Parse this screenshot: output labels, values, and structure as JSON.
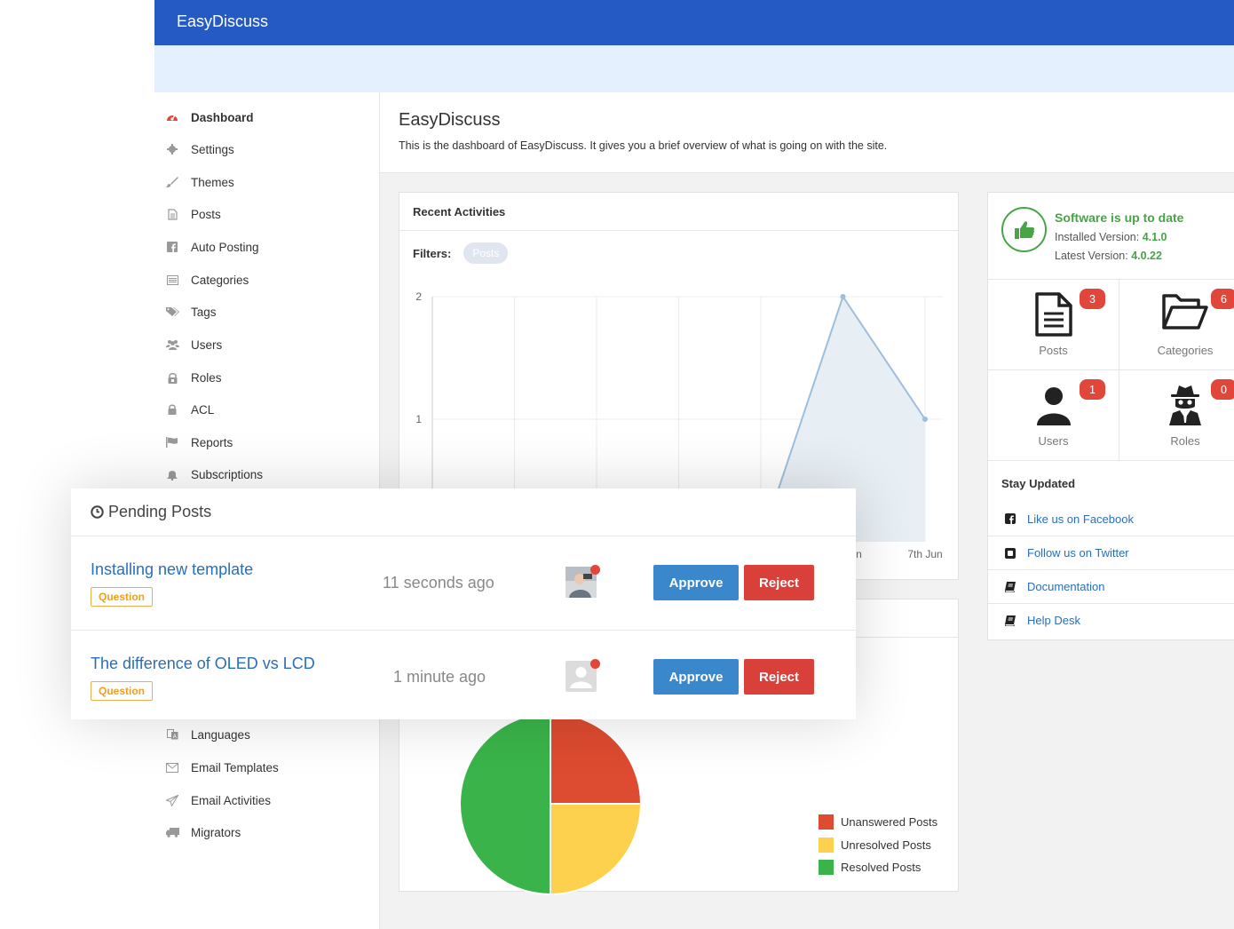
{
  "app": {
    "brand": "EasyDiscuss"
  },
  "sidebar": {
    "items": [
      {
        "label": "Dashboard",
        "icon": "dashboard-icon"
      },
      {
        "label": "Settings",
        "icon": "gear-icon"
      },
      {
        "label": "Themes",
        "icon": "brush-icon"
      },
      {
        "label": "Posts",
        "icon": "document-icon"
      },
      {
        "label": "Auto Posting",
        "icon": "facebook-icon"
      },
      {
        "label": "Categories",
        "icon": "list-icon"
      },
      {
        "label": "Tags",
        "icon": "tags-icon"
      },
      {
        "label": "Users",
        "icon": "users-icon"
      },
      {
        "label": "Roles",
        "icon": "roles-icon"
      },
      {
        "label": "ACL",
        "icon": "lock-icon"
      },
      {
        "label": "Reports",
        "icon": "flag-icon"
      },
      {
        "label": "Subscriptions",
        "icon": "bell-icon"
      },
      {
        "label": "Languages",
        "icon": "language-icon"
      },
      {
        "label": "Email Templates",
        "icon": "envelope-icon"
      },
      {
        "label": "Email Activities",
        "icon": "paper-plane-icon"
      },
      {
        "label": "Migrators",
        "icon": "truck-icon"
      }
    ]
  },
  "header": {
    "title": "EasyDiscuss",
    "description": "This is the dashboard of EasyDiscuss. It gives you a brief overview of what is going on with the site."
  },
  "activities": {
    "title": "Recent Activities",
    "filters_label": "Filters:",
    "filter_pill": "Posts"
  },
  "chart_data": [
    {
      "type": "area",
      "x_tick_labels": [
        "",
        "",
        "",
        "",
        "",
        "",
        "7th Jun"
      ],
      "x_label_partial": "n",
      "values": [
        0,
        0,
        0,
        0,
        0,
        2,
        1
      ],
      "ylim": [
        0,
        2
      ],
      "y_ticks": [
        1,
        2
      ],
      "grid": true,
      "colors": {
        "line": "#9ebfdb",
        "fill": "#e7eef4",
        "point": "#9ebfdb"
      }
    },
    {
      "type": "pie",
      "categories": [
        "Unanswered Posts",
        "Unresolved Posts",
        "Resolved Posts"
      ],
      "values": [
        25,
        25,
        50
      ],
      "colors": [
        "#dd4b30",
        "#fdd14e",
        "#3ab44a"
      ],
      "legend_position": "bottom-right"
    }
  ],
  "status": {
    "title": "Software is up to date",
    "installed_label": "Installed Version:",
    "installed_version": "4.1.0",
    "latest_label": "Latest Version:",
    "latest_version": "4.0.22"
  },
  "tiles": [
    {
      "label": "Posts",
      "count": "3",
      "icon": "document-icon"
    },
    {
      "label": "Categories",
      "count": "6",
      "icon": "folder-open-icon"
    },
    {
      "label": "Users",
      "count": "1",
      "icon": "user-icon"
    },
    {
      "label": "Roles",
      "count": "0",
      "icon": "spy-icon"
    }
  ],
  "stay_updated": {
    "title": "Stay Updated",
    "links": [
      {
        "label": "Like us on Facebook",
        "icon": "facebook-square-icon"
      },
      {
        "label": "Follow us on Twitter",
        "icon": "twitter-square-icon"
      },
      {
        "label": "Documentation",
        "icon": "book-icon"
      },
      {
        "label": "Help Desk",
        "icon": "book-icon"
      }
    ]
  },
  "pending": {
    "title": "Pending Posts",
    "approve_label": "Approve",
    "reject_label": "Reject",
    "posts": [
      {
        "title": "Installing new template",
        "tag": "Question",
        "time": "11 seconds ago",
        "avatar": "photo-avatar"
      },
      {
        "title": "The difference of OLED vs LCD",
        "tag": "Question",
        "time": "1 minute ago",
        "avatar": "default-avatar"
      }
    ]
  }
}
